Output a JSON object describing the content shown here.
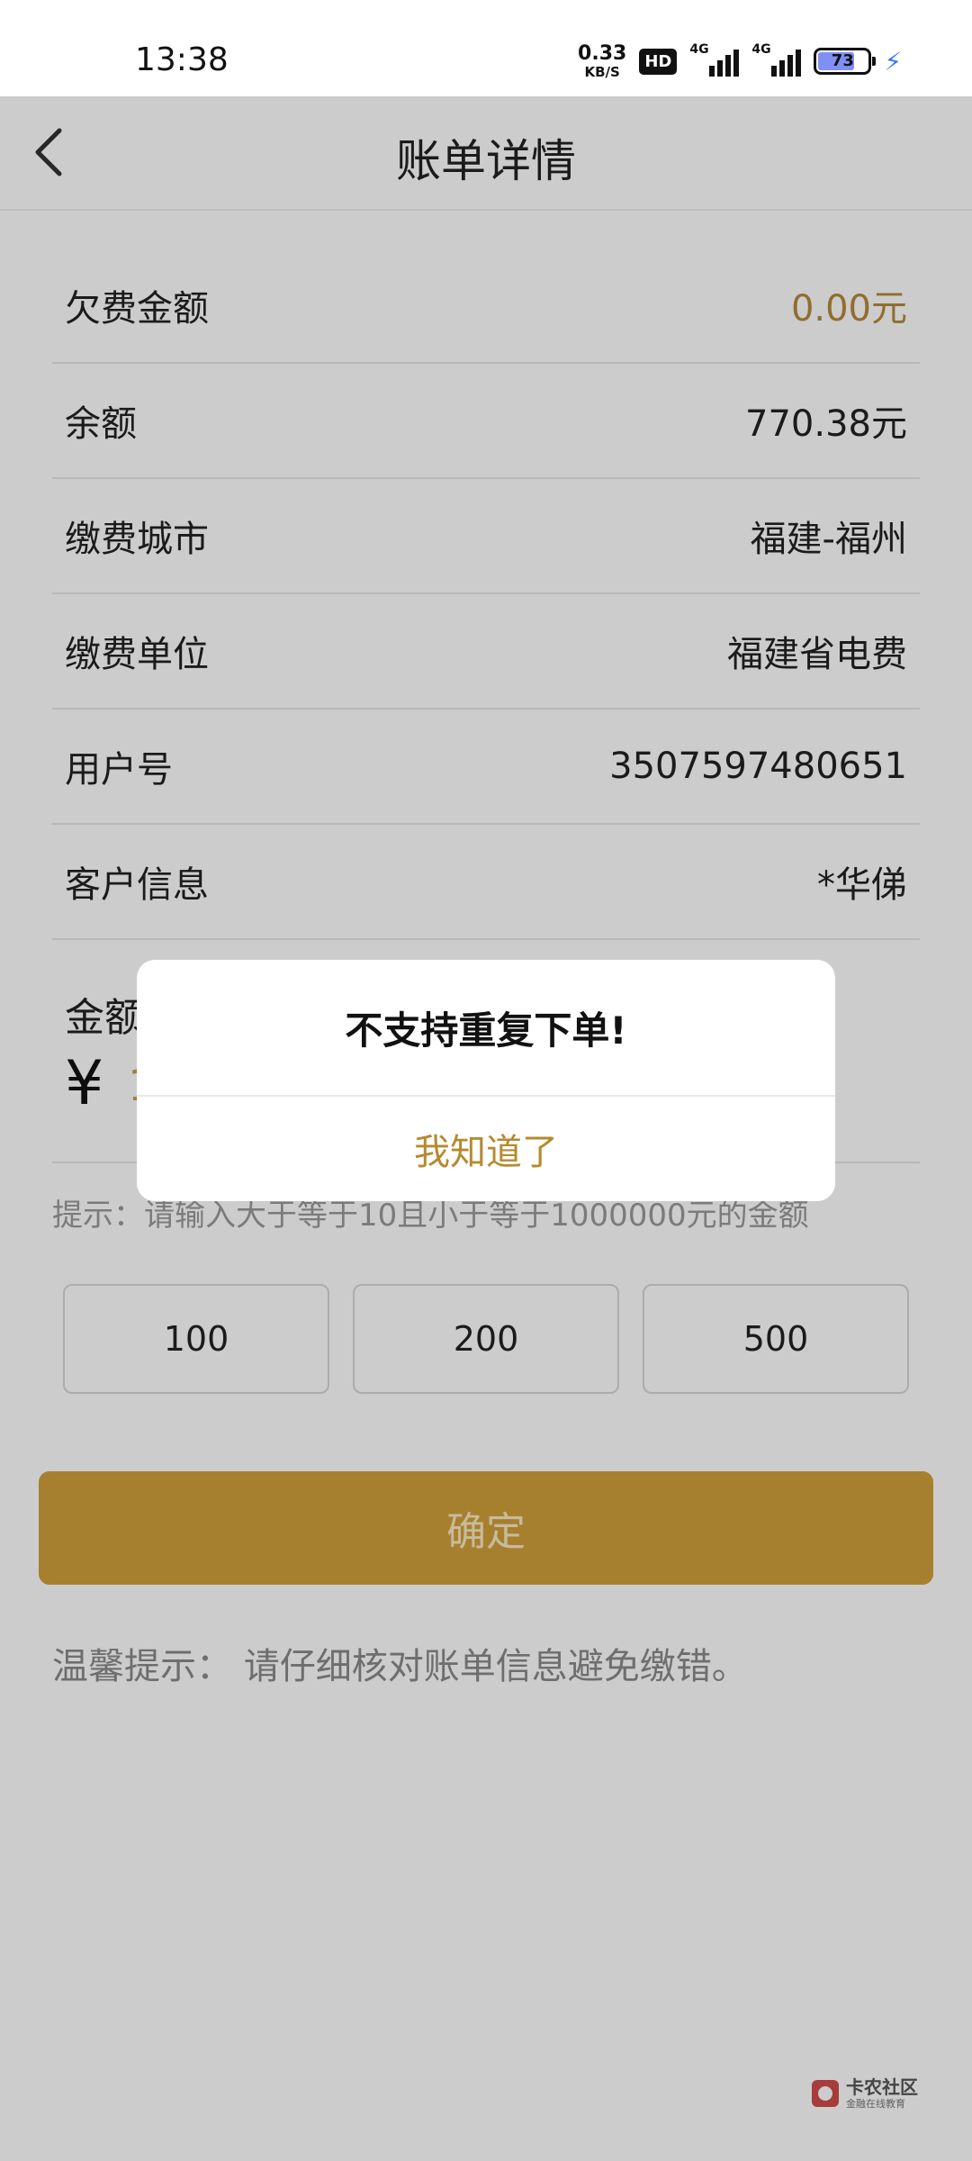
{
  "status_bar": {
    "time": "13:38",
    "net_speed_value": "0.33",
    "net_speed_unit": "KB/S",
    "hd_label": "HD",
    "signal1_label": "4G",
    "signal2_label": "4G",
    "battery_level": "73"
  },
  "nav": {
    "title": "账单详情"
  },
  "rows": [
    {
      "label": "欠费金额",
      "value": "0.00元"
    },
    {
      "label": "余额",
      "value": "770.38元"
    },
    {
      "label": "缴费城市",
      "value": "福建-福州"
    },
    {
      "label": "缴费单位",
      "value": "福建省电费"
    },
    {
      "label": "用户号",
      "value": "3507597480651"
    },
    {
      "label": "客户信息",
      "value": "*华俤"
    }
  ],
  "amount": {
    "label": "金额",
    "currency": "¥",
    "value": "1"
  },
  "hint": "提示：请输入大于等于10且小于等于1000000元的金额",
  "chips": [
    "100",
    "200",
    "500"
  ],
  "confirm_label": "确定",
  "tip": "温馨提示：  请仔细核对账单信息避免缴错。",
  "dialog": {
    "message": "不支持重复下单!",
    "ok_label": "我知道了"
  },
  "watermark": {
    "title": "卡农社区",
    "subtitle": "金融在线教育"
  },
  "colors": {
    "accent": "#b7893a",
    "button": "#d1a03b"
  }
}
